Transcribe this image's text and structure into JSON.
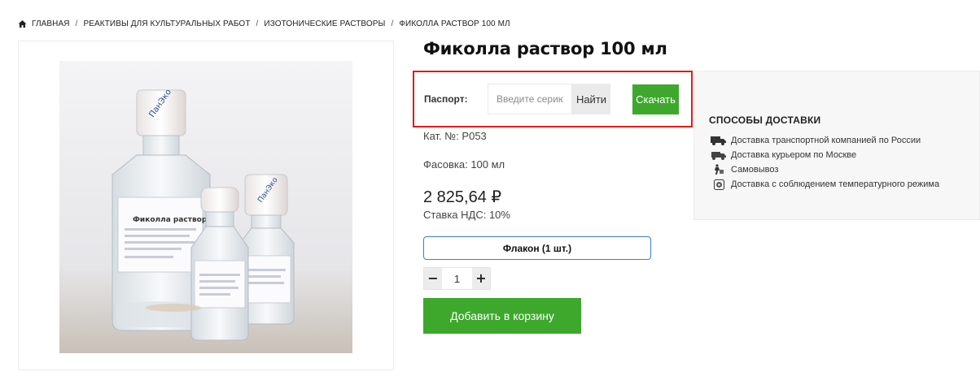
{
  "breadcrumb": {
    "icon": "home-icon",
    "items": [
      "ГЛАВНАЯ",
      "РЕАКТИВЫ ДЛЯ КУЛЬТУРАЛЬНЫХ РАБОТ",
      "ИЗОТОНИЧЕСКИЕ РАСТВОРЫ",
      "ФИКОЛЛА РАСТВОР 100 МЛ"
    ],
    "separator": "/"
  },
  "product": {
    "title": "Фиколла раствор 100 мл",
    "catalog": "Кат. №: Р053",
    "packing": "Фасовка: 100 мл",
    "price": "2 825,64 ₽",
    "vat": "Ставка НДС: 10%",
    "variant_label": "Флакон (1 шт.)",
    "quantity": "1",
    "decrement": "−",
    "increment": "+",
    "add_to_cart": "Добавить в корзину"
  },
  "passport": {
    "label": "Паспорт:",
    "placeholder": "Введите серию",
    "find_label": "Найти",
    "download_label": "Скачать",
    "highlight_color": "#e01b1b"
  },
  "delivery": {
    "title": "СПОСОБЫ ДОСТАВКИ",
    "items": [
      {
        "icon": "truck-icon",
        "label": "Доставка транспортной компанией по России"
      },
      {
        "icon": "courier-truck-icon",
        "label": "Доставка курьером по Москве"
      },
      {
        "icon": "pickup-icon",
        "label": "Самовывоз"
      },
      {
        "icon": "temperature-icon",
        "label": "Доставка с соблюдением температурного режима"
      }
    ]
  },
  "photo": {
    "icon": "product-photo",
    "label_brand": "ПанЭко",
    "label_text": "Фиколла раствор"
  },
  "colors": {
    "accent_green": "#3ea82d",
    "variant_border": "#3d7fd1",
    "panel_bg": "#f7f7f7"
  }
}
